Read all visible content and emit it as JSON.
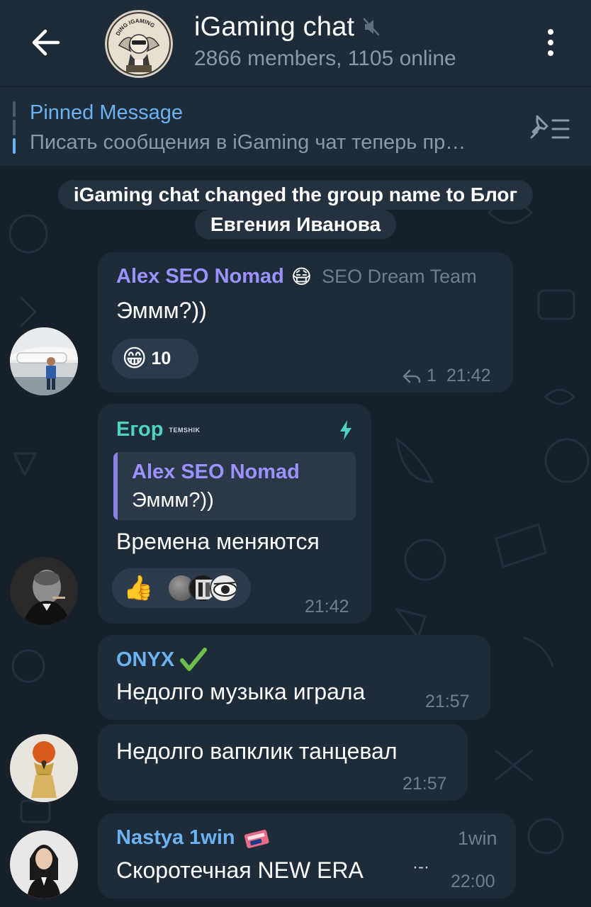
{
  "header": {
    "title": "iGaming chat",
    "subtitle": "2866 members, 1105 online",
    "muted_icon": "muted-speaker-icon",
    "back_icon": "back-arrow-icon",
    "menu_icon": "more-vert-icon",
    "avatar_text": "DING IGAMING"
  },
  "pinned": {
    "title": "Pinned Message",
    "text": "Писать сообщения в iGaming чат теперь пр…",
    "list_icon": "pinned-list-icon"
  },
  "service_message": {
    "line1": "iGaming chat changed the group name to Блог",
    "line2": "Евгения Иванова"
  },
  "messages": [
    {
      "sender": "Alex SEO Nomad",
      "sender_color": "#9c92ff",
      "sender_emoji": "😷",
      "badge": "SEO Dream Team",
      "text": "Эммм?))",
      "reaction": {
        "emoji": "😁",
        "count": "10"
      },
      "reply_count": "1",
      "time": "21:42"
    },
    {
      "sender": "Егор",
      "sender_color": "#4fd2c2",
      "sender_tag": "TEMSHIK",
      "quote_sender": "Alex SEO Nomad",
      "quote_text": "Эммм?))",
      "text": "Времена меняются",
      "reaction": {
        "emoji": "👍"
      },
      "time": "21:42"
    },
    {
      "sender": "ONYX",
      "sender_color": "#6ab2f2",
      "sender_emoji": "✔",
      "text": "Недолго музыка играла",
      "time": "21:57"
    },
    {
      "text": "Недолго вапклик танцевал",
      "time": "21:57"
    },
    {
      "sender": "Nastya 1win",
      "sender_color": "#6ab2f2",
      "badge": "1win",
      "text": "Скоротечная NEW ERA",
      "text_suffix": "·-·",
      "time": "22:00"
    }
  ]
}
